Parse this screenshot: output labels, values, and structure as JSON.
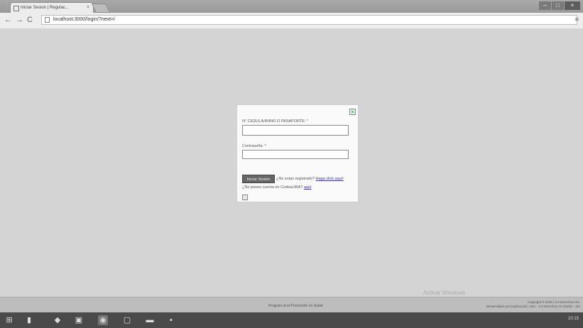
{
  "browser": {
    "tab_title": "Iniciar Sesion | Regulac...",
    "tab_close": "×",
    "address": "localhost:3000/login/?next=/",
    "nav": {
      "back": "←",
      "forward": "→",
      "reload": "C"
    },
    "menu_glyph": "≡",
    "window": {
      "minimize": "–",
      "maximize": "□",
      "close": "×"
    }
  },
  "login": {
    "username_label": "N° CEDULA/ANNO O PASAPORTE: *",
    "password_label": "Contraseña: *",
    "login_button": "Iniciar Sesión",
    "not_registered_text": "¿No estas registrado?",
    "register_link": "Haga click aquí!",
    "no_account_text": "¿No posee cuenta en CodeacIRA?",
    "no_account_link": "aquí"
  },
  "footer": {
    "center_text": "Program at el Promoción en Salud",
    "right_line1": "Copyright © 2015 | 2.0 Derechos res.",
    "right_line2": "Desarrollado por Exploración, Intrn - 2.0 Derechos en Diseño - DU",
    "watermark": "Activar Windows"
  },
  "taskbar": {
    "icons": [
      "start-icon",
      "file-explorer-icon",
      "store-icon",
      "explorer-icon",
      "chrome-icon",
      "app-icon",
      "terminal-icon",
      "save-icon"
    ],
    "tray_time": "10:15"
  }
}
